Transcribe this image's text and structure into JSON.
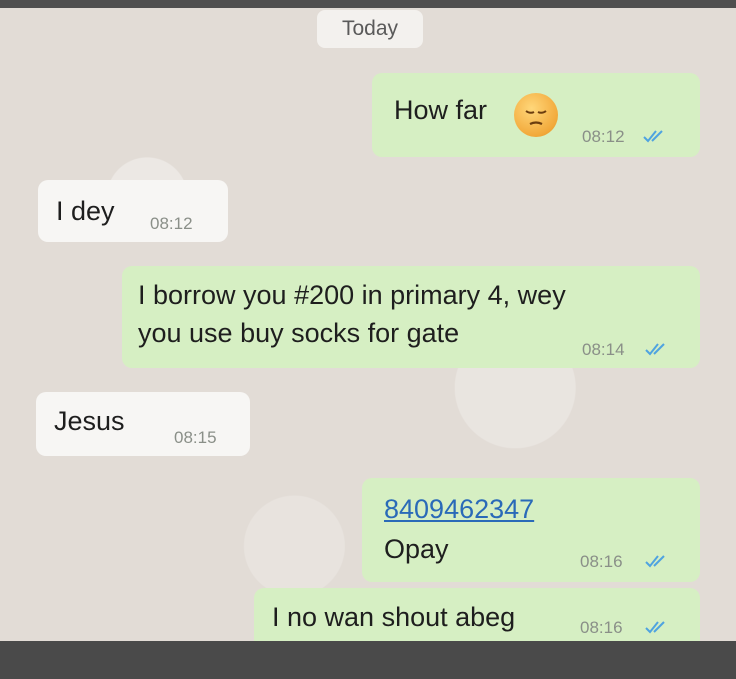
{
  "date_separator": "Today",
  "messages": [
    {
      "direction": "outgoing",
      "text": "How far",
      "emoji": "pensive-face-emoji",
      "time": "08:12",
      "status": "read"
    },
    {
      "direction": "incoming",
      "text": "I dey",
      "time": "08:12"
    },
    {
      "direction": "outgoing",
      "lines": [
        "I borrow you #200 in primary 4, wey",
        "you use buy socks for gate"
      ],
      "time": "08:14",
      "status": "read"
    },
    {
      "direction": "incoming",
      "text": "Jesus",
      "time": "08:15"
    },
    {
      "direction": "outgoing",
      "link": "8409462347",
      "text": "Opay",
      "time": "08:16",
      "status": "read"
    },
    {
      "direction": "outgoing",
      "text": "I no wan shout abeg",
      "time": "08:16",
      "status": "read"
    }
  ],
  "colors": {
    "outgoing_bubble": "#d6efc3",
    "incoming_bubble": "#f7f6f4",
    "read_ticks": "#4fa3e0",
    "link": "#2a6ab8"
  }
}
